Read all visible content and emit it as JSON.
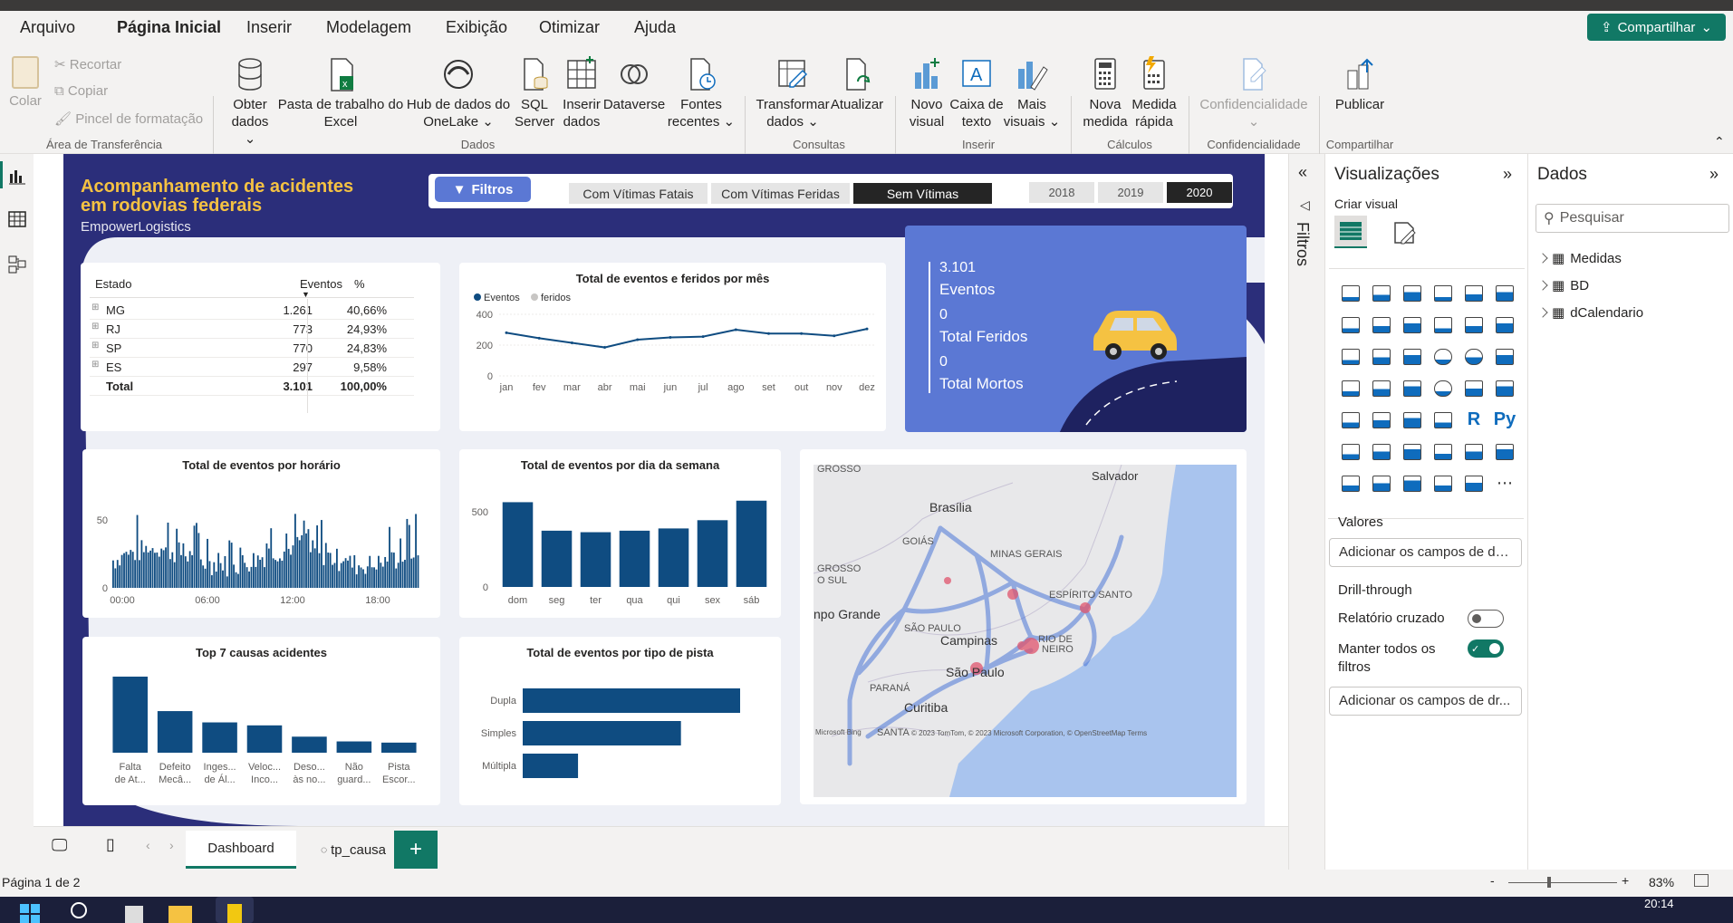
{
  "menu": [
    "Arquivo",
    "Página Inicial",
    "Inserir",
    "Modelagem",
    "Exibição",
    "Otimizar",
    "Ajuda"
  ],
  "share_label": "Compartilhar",
  "ribbon": {
    "clipboard": {
      "paste": "Colar",
      "cut": "Recortar",
      "copy": "Copiar",
      "format": "Pincel de formatação",
      "group": "Área de Transferência"
    },
    "data_buttons": [
      {
        "l1": "Obter",
        "l2": "dados ⌄"
      },
      {
        "l1": "Pasta de trabalho do",
        "l2": "Excel"
      },
      {
        "l1": "Hub de dados do",
        "l2": "OneLake ⌄"
      },
      {
        "l1": "SQL",
        "l2": "Server"
      },
      {
        "l1": "Inserir",
        "l2": "dados"
      },
      {
        "l1": "Dataverse",
        "l2": ""
      },
      {
        "l1": "Fontes",
        "l2": "recentes ⌄"
      }
    ],
    "data_group": "Dados",
    "query_buttons": [
      {
        "l1": "Transformar",
        "l2": "dados ⌄"
      },
      {
        "l1": "Atualizar",
        "l2": ""
      }
    ],
    "query_group": "Consultas",
    "insert_buttons": [
      {
        "l1": "Novo",
        "l2": "visual"
      },
      {
        "l1": "Caixa de",
        "l2": "texto"
      },
      {
        "l1": "Mais",
        "l2": "visuais ⌄"
      }
    ],
    "insert_group": "Inserir",
    "calc_buttons": [
      {
        "l1": "Nova",
        "l2": "medida"
      },
      {
        "l1": "Medida",
        "l2": "rápida"
      }
    ],
    "calc_group": "Cálculos",
    "conf_button": "Confidencialidade",
    "conf_group": "Confidencialidade",
    "publish_button": "Publicar",
    "publish_group": "Compartilhar"
  },
  "report": {
    "title_line1": "Acompanhamento de acidentes",
    "title_line2": "em rodovias federais",
    "company": "EmpowerLogistics",
    "filters_button": "Filtros",
    "slicer_types": [
      "Com Vítimas Fatais",
      "Com Vítimas Feridas",
      "Sem Vítimas"
    ],
    "slicer_type_selected": "Sem Vítimas",
    "slicer_years": [
      "2018",
      "2019",
      "2020"
    ],
    "slicer_year_selected": "2020",
    "state_table": {
      "headers": [
        "Estado",
        "Eventos",
        "%"
      ],
      "rows": [
        [
          "MG",
          "1.261",
          "40,66%"
        ],
        [
          "RJ",
          "773",
          "24,93%"
        ],
        [
          "SP",
          "770",
          "24,83%"
        ],
        [
          "ES",
          "297",
          "9,58%"
        ]
      ],
      "total": [
        "Total",
        "3.101",
        "100,00%"
      ]
    },
    "kpi": {
      "events_value": "3.101",
      "events_label": "Eventos",
      "injured_value": "0",
      "injured_label": "Total Feridos",
      "dead_value": "0",
      "dead_label": "Total Mortos"
    },
    "map": {
      "labels": [
        "GROSSO",
        "Salvador",
        "Brasília",
        "GOIÁS",
        "MINAS GERAIS",
        "ESPÍRITO SANTO",
        "GROSSO",
        "O SUL",
        "npo Grande",
        "SÃO PAULO",
        "Campinas",
        "RIO DE",
        "NEIRO",
        "PARANÁ",
        "São Paulo",
        "Curitiba",
        "SANTA"
      ],
      "attribution": "© 2023 TomTom, © 2023 Microsoft Corporation, © OpenStreetMap Terms",
      "logo": "Microsoft Bing"
    }
  },
  "chart_data": [
    {
      "type": "line",
      "title": "Total de eventos e feridos por mês",
      "legend": [
        "Eventos",
        "feridos"
      ],
      "legend_position": "top-left",
      "categories": [
        "jan",
        "fev",
        "mar",
        "abr",
        "mai",
        "jun",
        "jul",
        "ago",
        "set",
        "out",
        "nov",
        "dez"
      ],
      "series": [
        {
          "name": "Eventos",
          "values": [
            280,
            245,
            215,
            185,
            235,
            250,
            255,
            300,
            275,
            275,
            260,
            305
          ]
        }
      ],
      "yticks": [
        "400",
        "200",
        "0"
      ],
      "ylim": [
        0,
        400
      ]
    },
    {
      "type": "bar",
      "title": "Total de eventos por horário",
      "xticks": [
        "00:00",
        "06:00",
        "12:00",
        "18:00"
      ],
      "yticks": [
        "50",
        "0"
      ],
      "ylim": [
        0,
        70
      ]
    },
    {
      "type": "bar",
      "title": "Total de eventos por dia da semana",
      "categories": [
        "dom",
        "seg",
        "ter",
        "qua",
        "qui",
        "sex",
        "sáb"
      ],
      "values": [
        565,
        375,
        365,
        375,
        390,
        445,
        575
      ],
      "yticks": [
        "500",
        "0"
      ],
      "ylim": [
        0,
        640
      ]
    },
    {
      "type": "bar",
      "title": "Top 7 causas acidentes",
      "categories": [
        [
          "Falta",
          "de At..."
        ],
        [
          "Defeito",
          "Mecâ..."
        ],
        [
          "Inges...",
          "de Ál..."
        ],
        [
          "Veloc...",
          "Inco..."
        ],
        [
          "Deso...",
          "às no..."
        ],
        [
          "Não",
          "guard..."
        ],
        [
          "Pista",
          "Escor..."
        ]
      ],
      "values": [
        640,
        350,
        255,
        230,
        135,
        95,
        85
      ]
    },
    {
      "type": "bar",
      "orientation": "horizontal",
      "title": "Total de eventos por tipo de pista",
      "categories": [
        "Dupla",
        "Simples",
        "Múltipla"
      ],
      "values": [
        1690,
        1230,
        430
      ]
    }
  ],
  "panes": {
    "filters_label": "Filtros",
    "viz_title": "Visualizações",
    "build_visual": "Criar visual",
    "values_label": "Valores",
    "values_drop": "Adicionar os campos de da...",
    "drillthrough": "Drill-through",
    "cross_report": "Relatório cruzado",
    "keep_filters_1": "Manter todos os",
    "keep_filters_2": "filtros",
    "drill_drop": "Adicionar os campos de dr...",
    "data_title": "Dados",
    "search_placeholder": "Pesquisar",
    "fields": [
      "Medidas",
      "BD",
      "dCalendario"
    ]
  },
  "tabs": [
    "Dashboard",
    "tp_causa"
  ],
  "status": {
    "page": "Página 1 de 2",
    "zoom": "83%",
    "time": "20:14"
  },
  "colors": {
    "navy": "#2b2e7a",
    "accent": "#f5c242",
    "bar": "#0f4c81",
    "teal": "#117865",
    "kpi": "#5b78d4"
  }
}
